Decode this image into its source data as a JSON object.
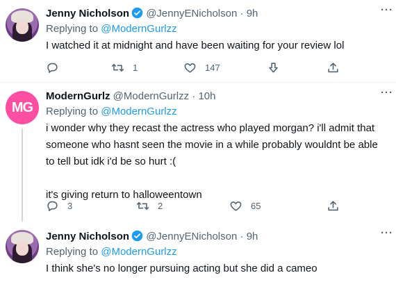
{
  "tweets": [
    {
      "name": "Jenny Nicholson",
      "verified": true,
      "handle": "@JennyENicholson",
      "dot": "·",
      "time": "9h",
      "replying_prefix": "Replying to",
      "replying_to": "@ModernGurlzz",
      "text": "I watched it at midnight and have been waiting for your review lol",
      "reply_count": "",
      "retweet_count": "1",
      "like_count": "147",
      "avatar_icon": "jenny-avatar"
    },
    {
      "name": "ModernGurlz",
      "verified": false,
      "handle": "@ModernGurlzz",
      "dot": "·",
      "time": "10h",
      "replying_prefix": "Replying to",
      "replying_to": "@ModernGurlzz",
      "text": "i wonder why they recast the actress who played morgan? i'll admit that someone who hasnt seen the movie in a while probably wouldnt be able to tell but idk i'd be so hurt :(\n\nit's giving return to halloweentown",
      "reply_count": "3",
      "retweet_count": "2",
      "like_count": "65",
      "avatar_text": "MG"
    },
    {
      "name": "Jenny Nicholson",
      "verified": true,
      "handle": "@JennyENicholson",
      "dot": "·",
      "time": "9h",
      "replying_prefix": "Replying to",
      "replying_to": "@ModernGurlzz",
      "text": "I think she's no longer pursuing acting but she did a cameo",
      "avatar_icon": "jenny-avatar"
    }
  ],
  "more_label": "···",
  "colors": {
    "accent": "#1d9bf0",
    "muted": "#536471",
    "mg_avatar": "#ff4fa3"
  }
}
